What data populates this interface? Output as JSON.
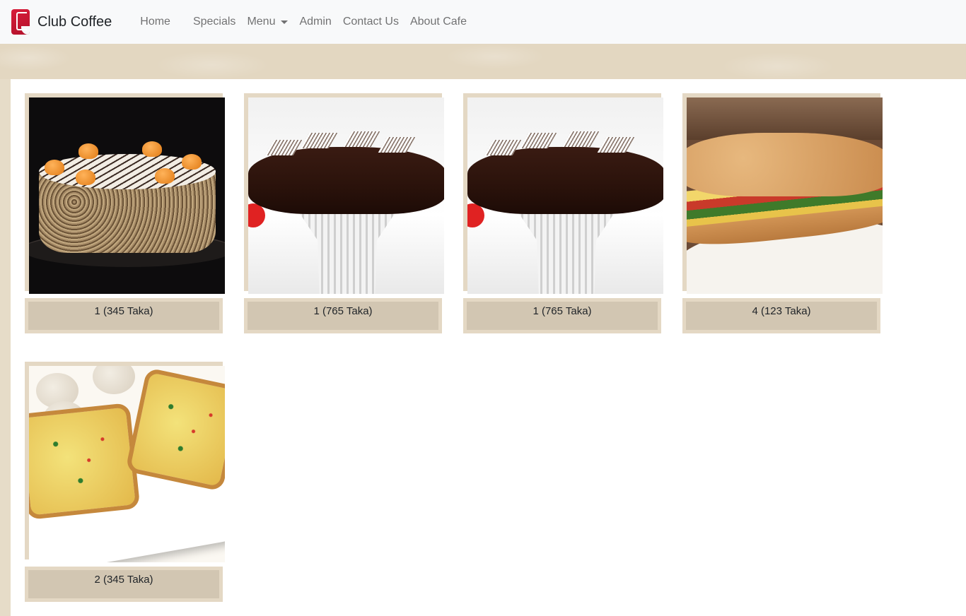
{
  "navbar": {
    "brand": "Club Coffee",
    "links": [
      {
        "label": "Home"
      },
      {
        "label": "Specials"
      },
      {
        "label": "Menu"
      },
      {
        "label": "Admin"
      },
      {
        "label": "Contact Us"
      },
      {
        "label": "About Cafe"
      }
    ]
  },
  "items": [
    {
      "label": "1 (345 Taka)",
      "image": "cake-orange-dollops"
    },
    {
      "label": "1 (765 Taka)",
      "image": "chocolate-cake-stand"
    },
    {
      "label": "1 (765 Taka)",
      "image": "chocolate-cake-stand"
    },
    {
      "label": "4 (123 Taka)",
      "image": "sandwich"
    },
    {
      "label": "2 (345 Taka)",
      "image": "garlic-bread"
    }
  ]
}
